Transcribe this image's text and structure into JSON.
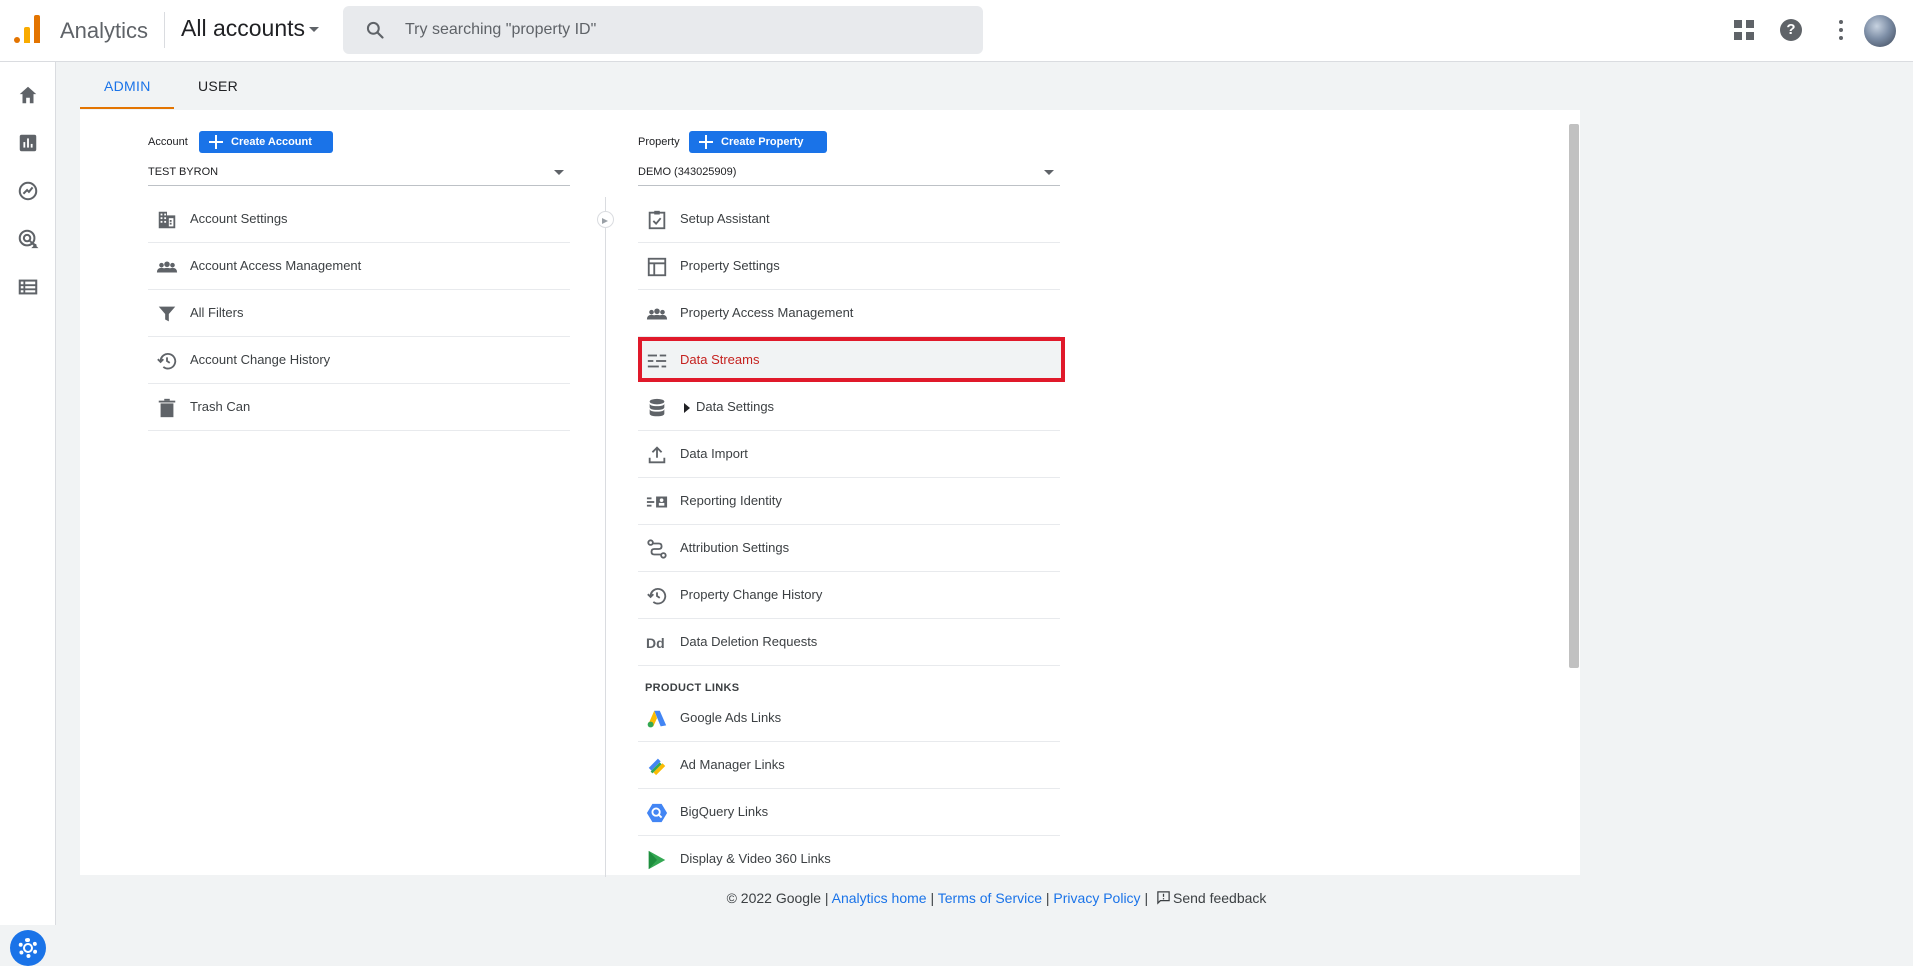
{
  "app": {
    "name": "Analytics",
    "accounts_label": "All accounts"
  },
  "search": {
    "placeholder": "Try searching \"property ID\""
  },
  "tabs": [
    {
      "label": "ADMIN",
      "active": true
    },
    {
      "label": "USER",
      "active": false
    }
  ],
  "account": {
    "label": "Account",
    "create_label": "Create Account",
    "selected": "TEST BYRON",
    "items": [
      {
        "label": "Account Settings",
        "icon": "building-icon"
      },
      {
        "label": "Account Access Management",
        "icon": "people-icon"
      },
      {
        "label": "All Filters",
        "icon": "filter-icon"
      },
      {
        "label": "Account Change History",
        "icon": "history-icon"
      },
      {
        "label": "Trash Can",
        "icon": "trash-icon"
      }
    ]
  },
  "property": {
    "label": "Property",
    "create_label": "Create Property",
    "selected": "DEMO (343025909)",
    "items": [
      {
        "label": "Setup Assistant",
        "icon": "checklist-icon"
      },
      {
        "label": "Property Settings",
        "icon": "layout-icon"
      },
      {
        "label": "Property Access Management",
        "icon": "people-icon"
      },
      {
        "label": "Data Streams",
        "icon": "streams-icon",
        "highlighted": true
      },
      {
        "label": "Data Settings",
        "icon": "database-icon",
        "expandable": true
      },
      {
        "label": "Data Import",
        "icon": "upload-icon"
      },
      {
        "label": "Reporting Identity",
        "icon": "identity-icon"
      },
      {
        "label": "Attribution Settings",
        "icon": "attribution-icon"
      },
      {
        "label": "Property Change History",
        "icon": "history-icon"
      },
      {
        "label": "Data Deletion Requests",
        "icon": "dd-icon"
      }
    ],
    "product_links_heading": "PRODUCT LINKS",
    "product_links": [
      {
        "label": "Google Ads Links",
        "icon": "google-ads-icon"
      },
      {
        "label": "Ad Manager Links",
        "icon": "ad-manager-icon"
      },
      {
        "label": "BigQuery Links",
        "icon": "bigquery-icon"
      },
      {
        "label": "Display & Video 360 Links",
        "icon": "dv360-icon"
      }
    ]
  },
  "footer": {
    "copyright": "© 2022 Google |",
    "analytics_home": "Analytics home",
    "terms": "Terms of Service",
    "privacy": "Privacy Policy",
    "feedback": "Send feedback",
    "sep": "|"
  },
  "colors": {
    "accent": "#1a73e8",
    "tab_underline": "#e37400",
    "highlight_border": "#e0192a"
  }
}
